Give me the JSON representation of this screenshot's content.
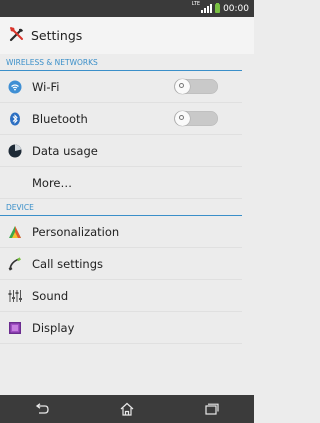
{
  "status_bar": {
    "network": "LTE",
    "time": "00:00",
    "icons": [
      "signal-icon",
      "battery-icon"
    ]
  },
  "action_bar": {
    "title": "Settings",
    "icon": "settings-tools-icon"
  },
  "sections": [
    {
      "header": "WIRELESS & NETWORKS",
      "items": [
        {
          "label": "Wi-Fi",
          "icon": "wifi-icon",
          "toggle": "off"
        },
        {
          "label": "Bluetooth",
          "icon": "bluetooth-icon",
          "toggle": "off"
        },
        {
          "label": "Data usage",
          "icon": "data-usage-icon"
        },
        {
          "label": "More…"
        }
      ]
    },
    {
      "header": "DEVICE",
      "items": [
        {
          "label": "Personalization",
          "icon": "personalization-icon"
        },
        {
          "label": "Call settings",
          "icon": "phone-icon"
        },
        {
          "label": "Sound",
          "icon": "equalizer-icon"
        },
        {
          "label": "Display",
          "icon": "display-icon"
        }
      ]
    }
  ],
  "nav_bar": {
    "buttons": [
      "back-icon",
      "home-icon",
      "recent-apps-icon"
    ]
  },
  "colors": {
    "accent": "#3a8fc9",
    "status_bar": "#3a3a3a",
    "nav_bar": "#3b3b3b",
    "background": "#ececec"
  }
}
